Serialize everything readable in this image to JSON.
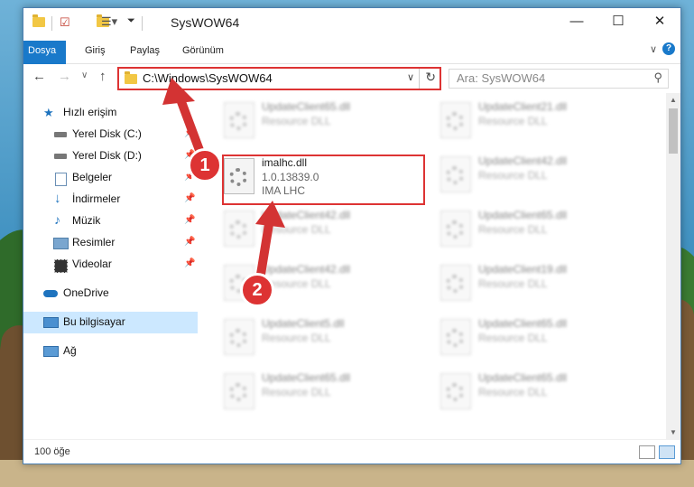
{
  "window": {
    "title": "SysWOW64",
    "controls": {
      "minimize": "—",
      "maximize": "☐",
      "close": "✕"
    }
  },
  "ribbon": {
    "tabs": [
      "Dosya",
      "Giriş",
      "Paylaş",
      "Görünüm"
    ],
    "help": "?"
  },
  "navbar": {
    "address": "C:\\Windows\\SysWOW64",
    "search_placeholder": "Ara: SysWOW64"
  },
  "sidebar": {
    "items": [
      {
        "label": "Hızlı erişim",
        "icon": "star-icon",
        "pinned": false
      },
      {
        "label": "Yerel Disk (C:)",
        "icon": "drive-icon",
        "pinned": true
      },
      {
        "label": "Yerel Disk (D:)",
        "icon": "drive-icon",
        "pinned": true
      },
      {
        "label": "Belgeler",
        "icon": "documents-icon",
        "pinned": true
      },
      {
        "label": "İndirmeler",
        "icon": "downloads-icon",
        "pinned": true
      },
      {
        "label": "Müzik",
        "icon": "music-icon",
        "pinned": true
      },
      {
        "label": "Resimler",
        "icon": "pictures-icon",
        "pinned": true
      },
      {
        "label": "Videolar",
        "icon": "videos-icon",
        "pinned": true
      },
      {
        "label": "OneDrive",
        "icon": "cloud-icon",
        "pinned": false
      },
      {
        "label": "Bu bilgisayar",
        "icon": "computer-icon",
        "pinned": false,
        "active": true
      },
      {
        "label": "Ağ",
        "icon": "network-icon",
        "pinned": false
      }
    ]
  },
  "files": {
    "featured": {
      "name": "imalhc.dll",
      "version": "1.0.13839.0",
      "company": "IMA LHC"
    },
    "blurred": [
      {
        "name": "UpdateClient65.dll",
        "desc": "Resource DLL"
      },
      {
        "name": "UpdateClient21.dll",
        "desc": "Resource DLL"
      },
      {
        "name": "UpdateClient42.dll",
        "desc": "Resource DLL"
      },
      {
        "name": "UpdateClient42.dll",
        "desc": "Resource DLL"
      },
      {
        "name": "UpdateClient65.dll",
        "desc": "Resource DLL"
      },
      {
        "name": "UpdateClient42.dll",
        "desc": "Resource DLL"
      },
      {
        "name": "UpdateClient19.dll",
        "desc": "Resource DLL"
      },
      {
        "name": "UpdateClient5.dll",
        "desc": "Resource DLL"
      },
      {
        "name": "UpdateClient65.dll",
        "desc": "Resource DLL"
      },
      {
        "name": "UpdateClient65.dll",
        "desc": "Resource DLL"
      },
      {
        "name": "UpdateClient65.dll",
        "desc": "Resource DLL"
      }
    ]
  },
  "status": {
    "count": "100 öğe"
  },
  "annotations": {
    "step1": "1",
    "step2": "2",
    "color": "#d33333"
  }
}
